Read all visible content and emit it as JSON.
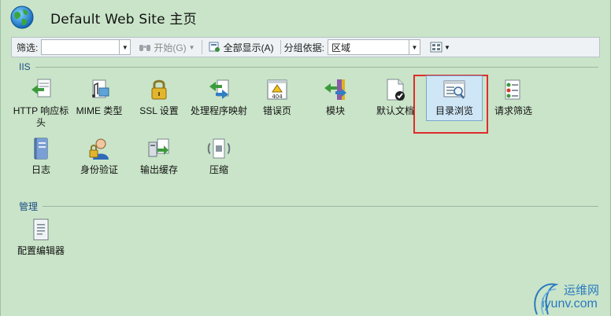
{
  "header": {
    "title": "Default Web Site 主页"
  },
  "toolbar": {
    "filter_label": "筛选:",
    "filter_value": "",
    "start_label": "开始(G)",
    "show_all_label": "全部显示(A)",
    "group_by_label": "分组依据:",
    "group_by_value": "区域"
  },
  "sections": {
    "iis": "IIS",
    "manage": "管理"
  },
  "iis_items": [
    {
      "label": "HTTP 响应标头",
      "icon": "http-response-icon"
    },
    {
      "label": "MIME 类型",
      "icon": "mime-icon"
    },
    {
      "label": "SSL 设置",
      "icon": "lock-icon"
    },
    {
      "label": "处理程序映射",
      "icon": "handler-icon"
    },
    {
      "label": "错误页",
      "icon": "error-page-icon"
    },
    {
      "label": "模块",
      "icon": "modules-icon"
    },
    {
      "label": "默认文档",
      "icon": "default-doc-icon"
    },
    {
      "label": "目录浏览",
      "icon": "directory-browse-icon"
    },
    {
      "label": "请求筛选",
      "icon": "request-filter-icon"
    },
    {
      "label": "日志",
      "icon": "log-icon"
    },
    {
      "label": "身份验证",
      "icon": "auth-icon"
    },
    {
      "label": "输出缓存",
      "icon": "output-cache-icon"
    },
    {
      "label": "压缩",
      "icon": "compress-icon"
    }
  ],
  "manage_items": [
    {
      "label": "配置编辑器",
      "icon": "config-editor-icon"
    }
  ],
  "watermark": {
    "name": "运维网",
    "url": "iyunv.com"
  },
  "colors": {
    "background": "#c9e4c8",
    "selection": "#e02b2b",
    "section": "#1f4d86"
  }
}
